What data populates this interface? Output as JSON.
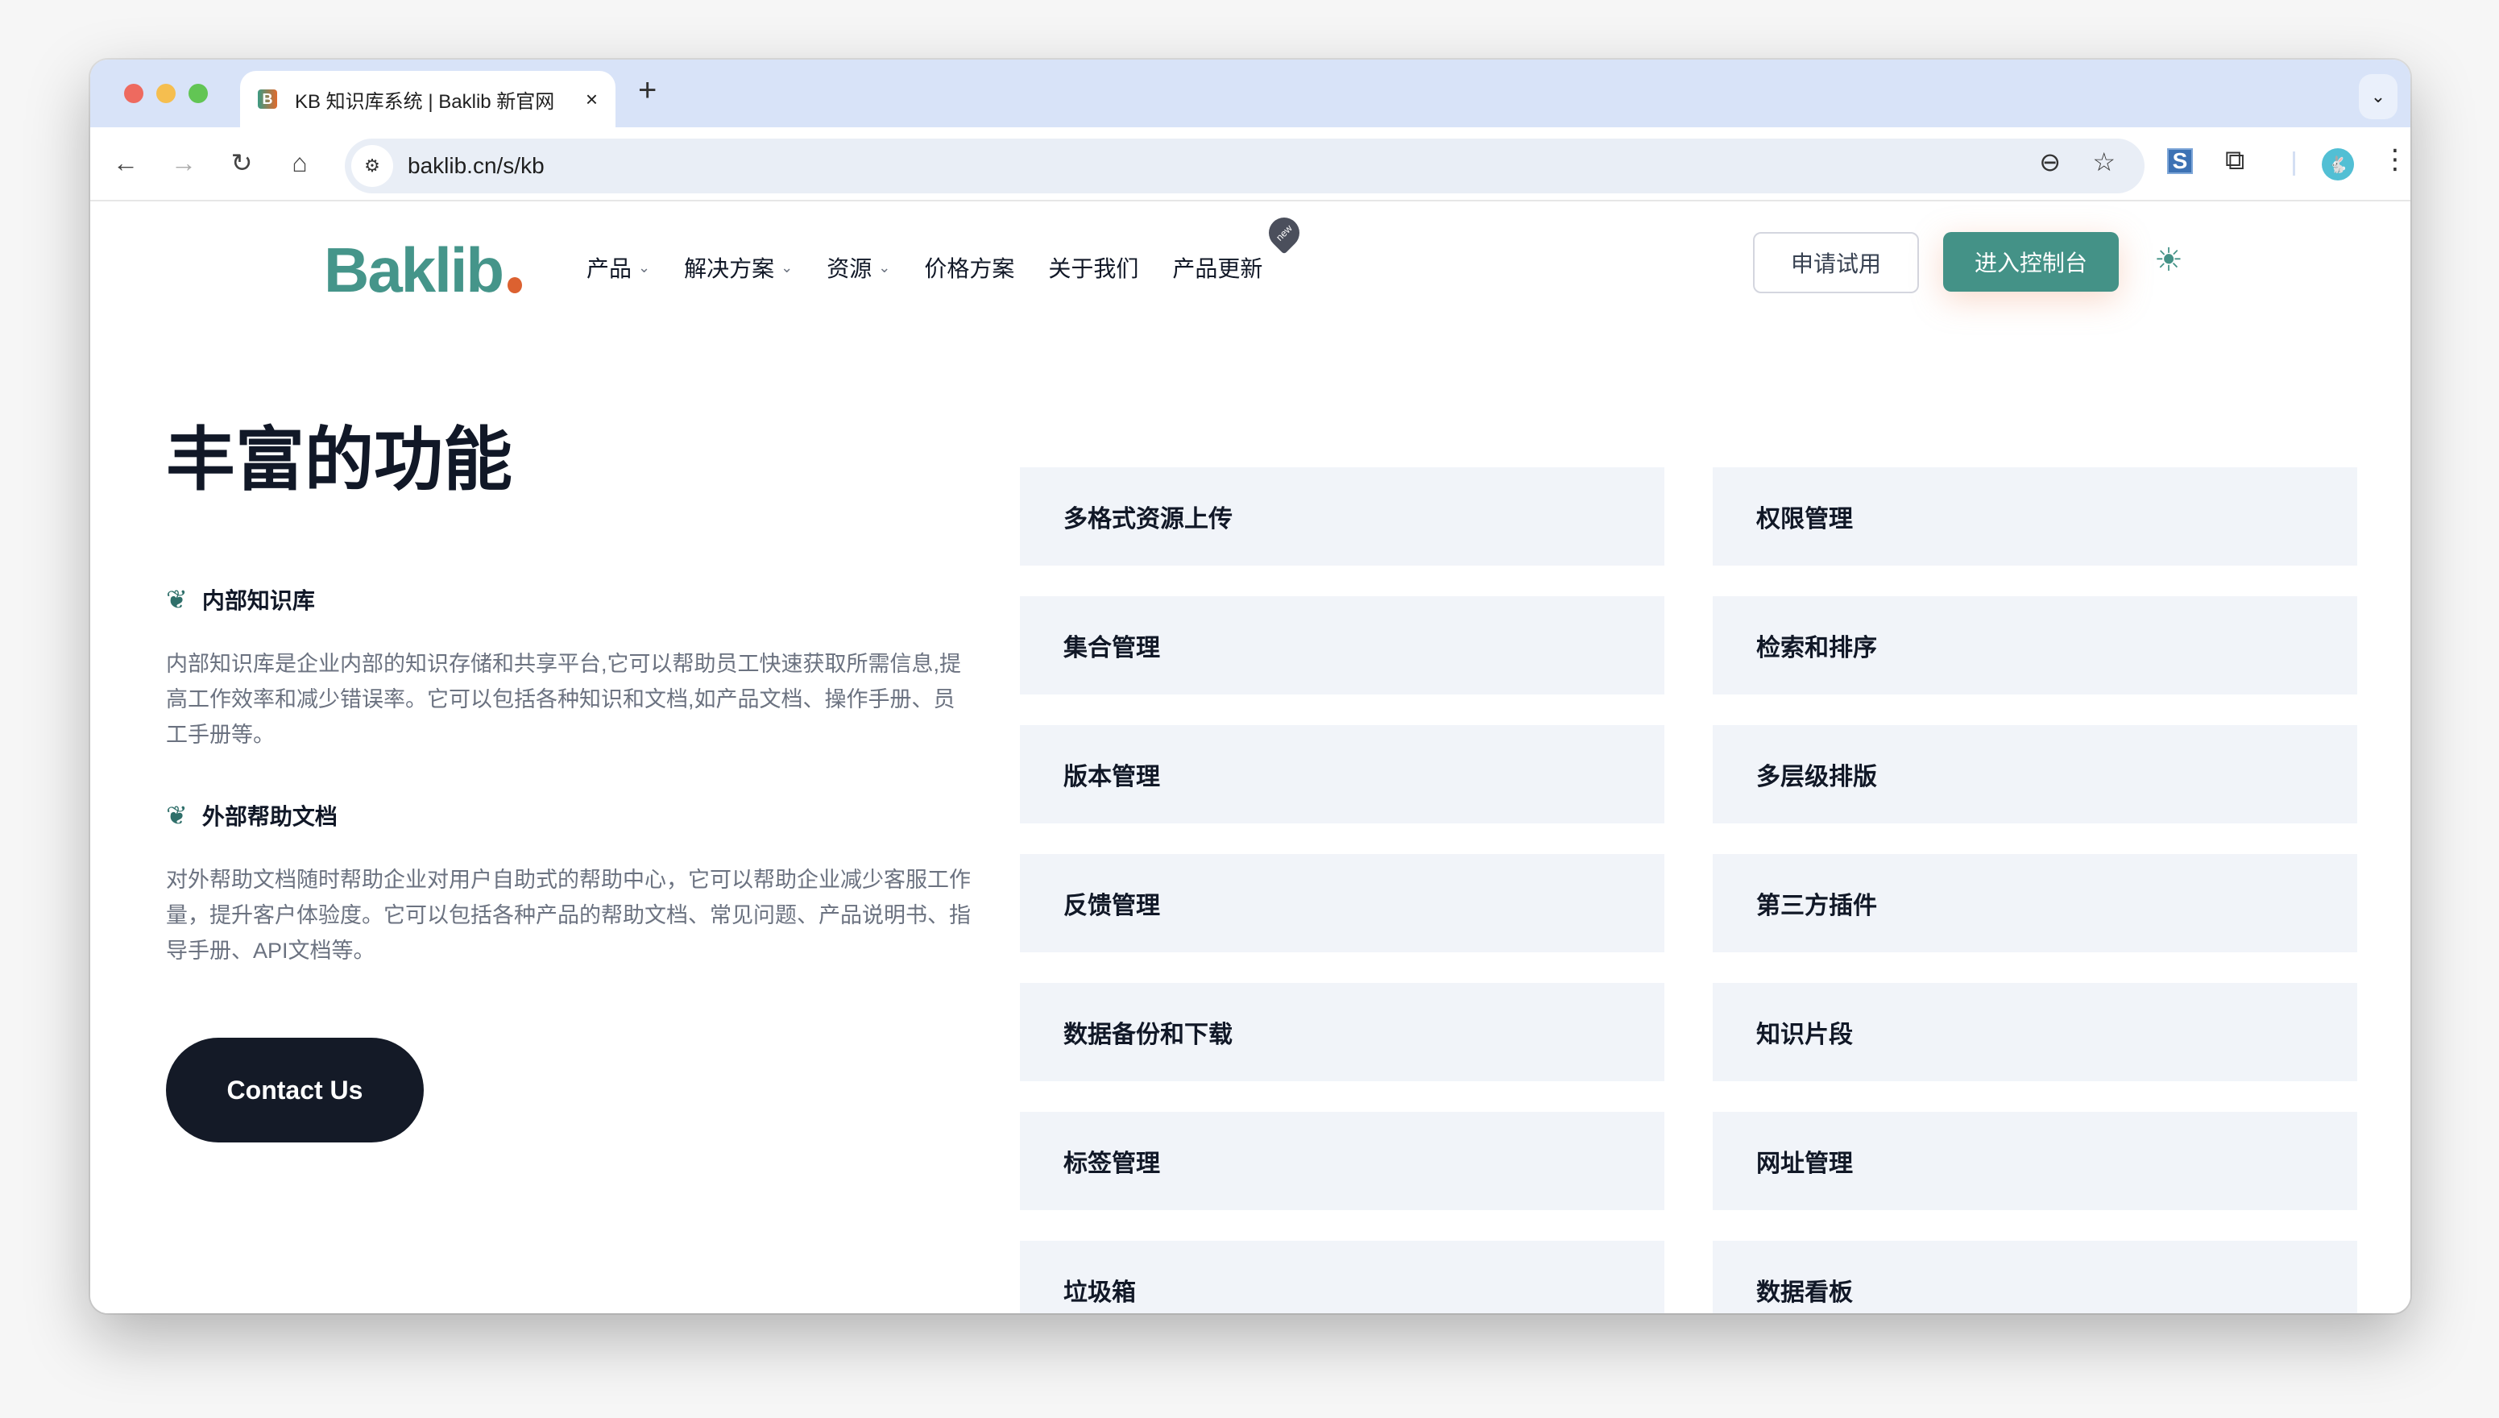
{
  "browser": {
    "tab": {
      "favicon": "B",
      "title": "KB 知识库系统 | Baklib 新官网",
      "close": "×"
    },
    "new_tab": "+",
    "tab_dropdown": "⌄",
    "nav": {
      "back": "←",
      "forward": "→",
      "reload": "↻",
      "home": "⌂"
    },
    "site_info_icon": "⚙",
    "url": "baklib.cn/s/kb",
    "zoom_icon": "⊖",
    "bookmark_icon": "☆",
    "extension_s": "S",
    "extensions_icon": "⧉",
    "avatar": "🐇",
    "menu_icon": "⋮"
  },
  "site": {
    "logo": "Baklib",
    "nav": [
      {
        "label": "产品",
        "chevron": "⌄"
      },
      {
        "label": "解决方案",
        "chevron": "⌄"
      },
      {
        "label": "资源",
        "chevron": "⌄"
      },
      {
        "label": "价格方案"
      },
      {
        "label": "关于我们"
      },
      {
        "label": "产品更新",
        "badge": "new"
      }
    ],
    "trial_button": "申请试用",
    "console_button": "进入控制台",
    "theme_icon": "☀",
    "brand_color": "#449287",
    "accent_color": "#dc6130"
  },
  "main": {
    "heading": "丰富的功能",
    "sections": [
      {
        "title": "内部知识库",
        "icon": "❦",
        "description": "内部知识库是企业内部的知识存储和共享平台,它可以帮助员工快速获取所需信息,提高工作效率和减少错误率。它可以包括各种知识和文档,如产品文档、操作手册、员工手册等。"
      },
      {
        "title": "外部帮助文档",
        "icon": "❦",
        "description": "对外帮助文档随时帮助企业对用户自助式的帮助中心，它可以帮助企业减少客服工作量，提升客户体验度。它可以包括各种产品的帮助文档、常见问题、产品说明书、指导手册、API文档等。"
      }
    ],
    "contact_button": "Contact Us",
    "features": [
      "多格式资源上传",
      "权限管理",
      "集合管理",
      "检索和排序",
      "版本管理",
      "多层级排版",
      "反馈管理",
      "第三方插件",
      "数据备份和下载",
      "知识片段",
      "标签管理",
      "网址管理",
      "垃圾箱",
      "数据看板"
    ]
  }
}
